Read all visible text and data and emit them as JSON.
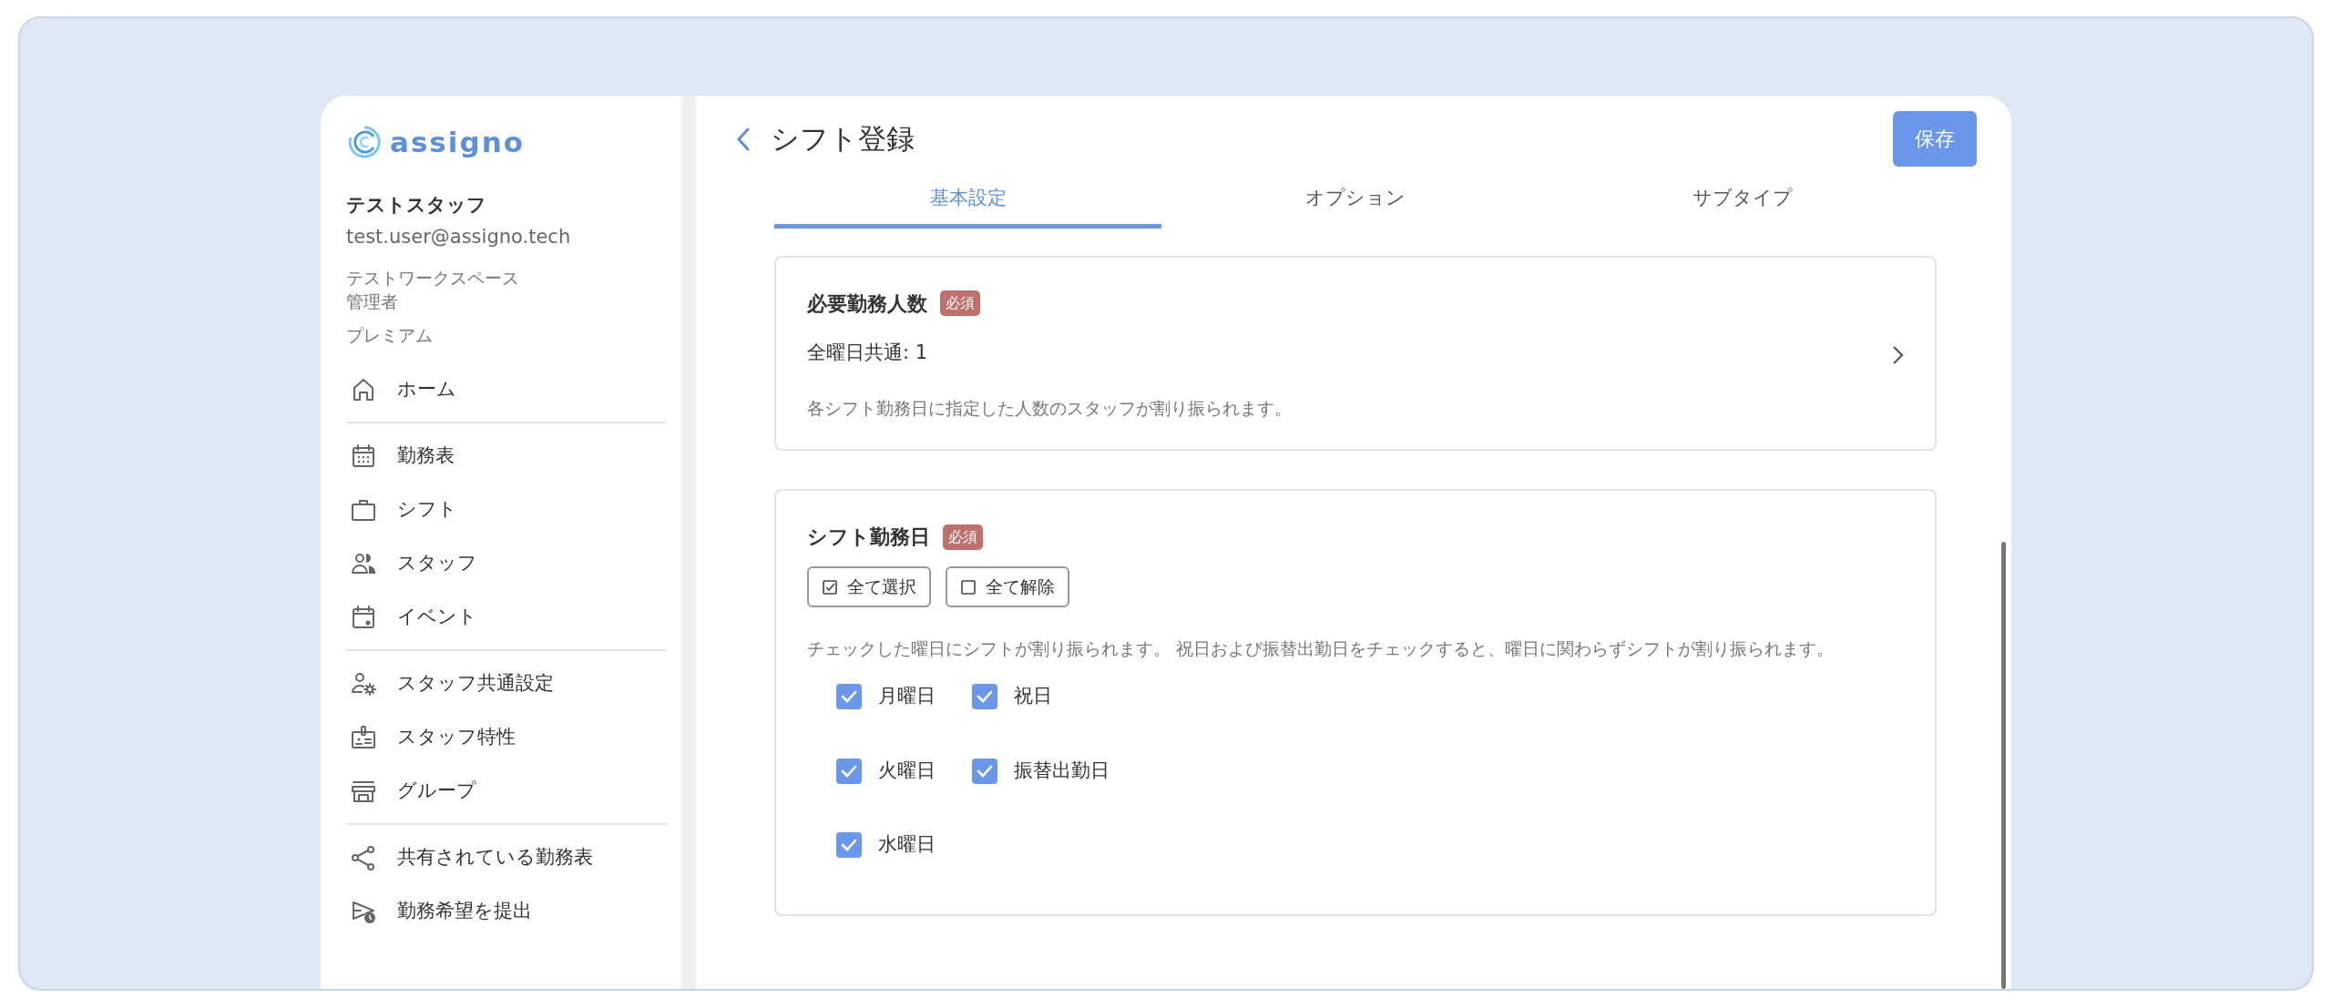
{
  "logo": {
    "text": "assigno"
  },
  "user": {
    "name": "テストスタッフ",
    "email": "test.user@assigno.tech",
    "workspace": "テストワークスペース",
    "role": "管理者",
    "plan": "プレミアム"
  },
  "nav_groups": [
    [
      {
        "label": "ホーム",
        "kind": "home"
      }
    ],
    [
      {
        "label": "勤務表",
        "kind": "calendar"
      },
      {
        "label": "シフト",
        "kind": "briefcase"
      },
      {
        "label": "スタッフ",
        "kind": "people"
      },
      {
        "label": "イベント",
        "kind": "event"
      }
    ],
    [
      {
        "label": "スタッフ共通設定",
        "kind": "person-gear"
      },
      {
        "label": "スタッフ特性",
        "kind": "badge"
      },
      {
        "label": "グループ",
        "kind": "store"
      }
    ],
    [
      {
        "label": "共有されている勤務表",
        "kind": "share"
      },
      {
        "label": "勤務希望を提出",
        "kind": "send-clock"
      }
    ]
  ],
  "header": {
    "title": "シフト登録",
    "save_button": "保存"
  },
  "tabs": [
    {
      "label": "基本設定",
      "selected": true
    },
    {
      "label": "オプション",
      "selected": false
    },
    {
      "label": "サブタイプ",
      "selected": false
    }
  ],
  "staff_card": {
    "title": "必要勤務人数",
    "badge": "必須",
    "summary": "全曜日共通: 1",
    "description": "各シフト勤務日に指定した人数のスタッフが割り振られます。"
  },
  "days_card": {
    "title": "シフト勤務日",
    "badge": "必須",
    "buttons": [
      {
        "label": "全て選択",
        "kind": "select_all"
      },
      {
        "label": "全て解除",
        "kind": "clear_all"
      }
    ],
    "description": "チェックした曜日にシフトが割り振られます。 祝日および振替出勤日をチェックすると、曜日に関わらずシフトが割り振られます。",
    "days": [
      {
        "label": "月曜日",
        "checked": true
      },
      {
        "label": "祝日",
        "checked": true
      },
      {
        "label": "火曜日",
        "checked": true
      },
      {
        "label": "振替出勤日",
        "checked": true
      },
      {
        "label": "水曜日",
        "checked": true
      }
    ]
  }
}
